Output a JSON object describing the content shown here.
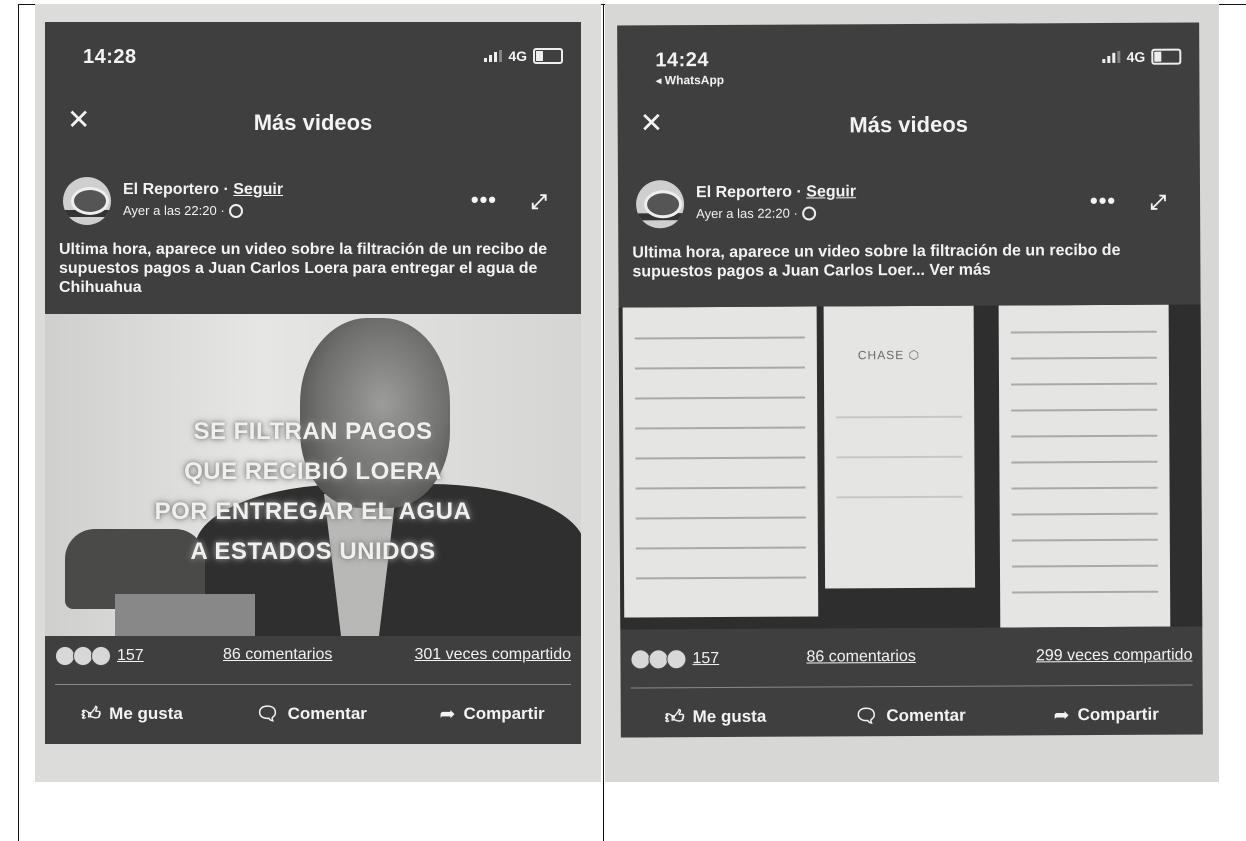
{
  "left": {
    "status": {
      "time": "14:28",
      "network": "4G"
    },
    "nav": {
      "close": "✕",
      "title": "Más videos"
    },
    "post": {
      "author": "El Reportero",
      "separator": "·",
      "follow": "Seguir",
      "timestamp": "Ayer a las 22:20 ·",
      "caption": "Ultima hora, aparece un video sobre la filtración de un recibo de supuestos pagos a Juan Carlos Loera para entregar el agua de Chihuahua",
      "overlay_lines": [
        "SE FILTRAN PAGOS",
        "QUE RECIBIÓ LOERA",
        "POR ENTREGAR EL AGUA",
        "A ESTADOS UNIDOS"
      ]
    },
    "stats": {
      "reactions": "157",
      "comments": "86 comentarios",
      "shares": "301 veces compartido"
    },
    "actions": {
      "like": "Me gusta",
      "comment": "Comentar",
      "share": "Compartir"
    }
  },
  "right": {
    "status": {
      "time": "14:24",
      "back": "◂ WhatsApp",
      "network": "4G"
    },
    "nav": {
      "close": "✕",
      "title": "Más videos"
    },
    "post": {
      "author": "El Reportero",
      "separator": "·",
      "follow": "Seguir",
      "timestamp": "Ayer a las 22:20 ·",
      "caption": "Ultima hora, aparece un video sobre la filtración de un recibo de supuestos pagos a Juan Carlos Loer... Ver más",
      "receipt_label": "CHASE ⬡"
    },
    "stats": {
      "reactions": "157",
      "comments": "86 comentarios",
      "shares": "299 veces compartido"
    },
    "actions": {
      "like": "Me gusta",
      "comment": "Comentar",
      "share": "Compartir"
    }
  },
  "icons": {
    "like": "like-icon",
    "comment": "comment-icon",
    "share": "share-icon",
    "more": "more-icon",
    "expand": "expand-icon",
    "globe": "globe-icon"
  }
}
